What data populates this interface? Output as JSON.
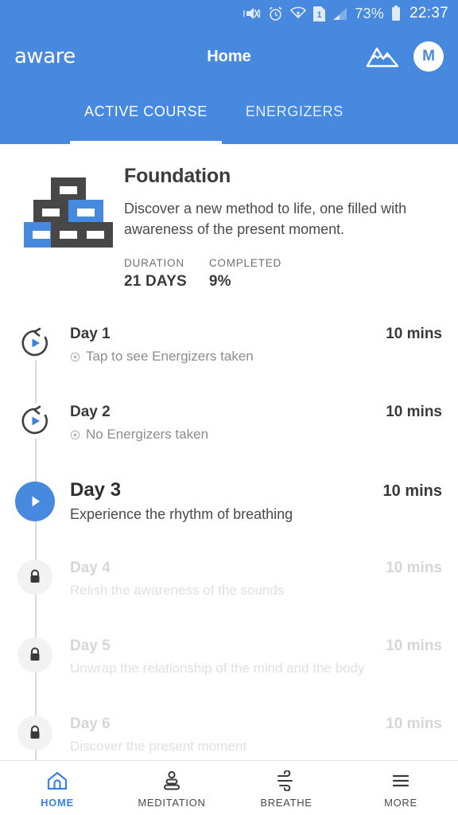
{
  "status_bar": {
    "icons": [
      "mute-vibrate-icon",
      "alarm-icon",
      "wifi-icon",
      "sim-1-icon",
      "signal-icon"
    ],
    "battery_percent": "73%",
    "clock": "22:37"
  },
  "app_bar": {
    "brand": "aware",
    "title": "Home",
    "mountain_icon": "mountain-icon",
    "avatar_initial": "M"
  },
  "tabs": [
    {
      "label": "ACTIVE COURSE",
      "active": true
    },
    {
      "label": "ENERGIZERS",
      "active": false
    }
  ],
  "course": {
    "title": "Foundation",
    "description": "Discover a new method to life, one filled with awareness of the present moment.",
    "duration_label": "DURATION",
    "duration_value": "21 DAYS",
    "completed_label": "COMPLETED",
    "completed_value": "9%"
  },
  "days": [
    {
      "name": "Day 1",
      "subtitle": "Tap to see Energizers taken",
      "duration": "10 mins",
      "state": "completed",
      "icon": "replay-play-icon"
    },
    {
      "name": "Day 2",
      "subtitle": "No Energizers taken",
      "duration": "10 mins",
      "state": "completed",
      "icon": "replay-play-icon"
    },
    {
      "name": "Day 3",
      "subtitle": "Experience the rhythm of breathing",
      "duration": "10 mins",
      "state": "current",
      "icon": "play-icon"
    },
    {
      "name": "Day 4",
      "subtitle": "Relish the awareness of the sounds",
      "duration": "10 mins",
      "state": "locked",
      "icon": "lock-icon"
    },
    {
      "name": "Day 5",
      "subtitle": "Unwrap the relationship of the mind and the body",
      "duration": "10 mins",
      "state": "locked",
      "icon": "lock-icon"
    },
    {
      "name": "Day 6",
      "subtitle": "Discover the present moment",
      "duration": "10 mins",
      "state": "locked",
      "icon": "lock-icon"
    }
  ],
  "bottom_nav": [
    {
      "label": "HOME",
      "icon": "home-icon",
      "active": true
    },
    {
      "label": "MEDITATION",
      "icon": "meditation-icon",
      "active": false
    },
    {
      "label": "BREATHE",
      "icon": "breathe-wind-icon",
      "active": false
    },
    {
      "label": "MORE",
      "icon": "hamburger-menu-icon",
      "active": false
    }
  ],
  "colors": {
    "brand_blue": "#4889e0",
    "accent_blue": "#3b82e0",
    "dark_block": "#474747",
    "locked_grey": "#d6d6d6"
  }
}
